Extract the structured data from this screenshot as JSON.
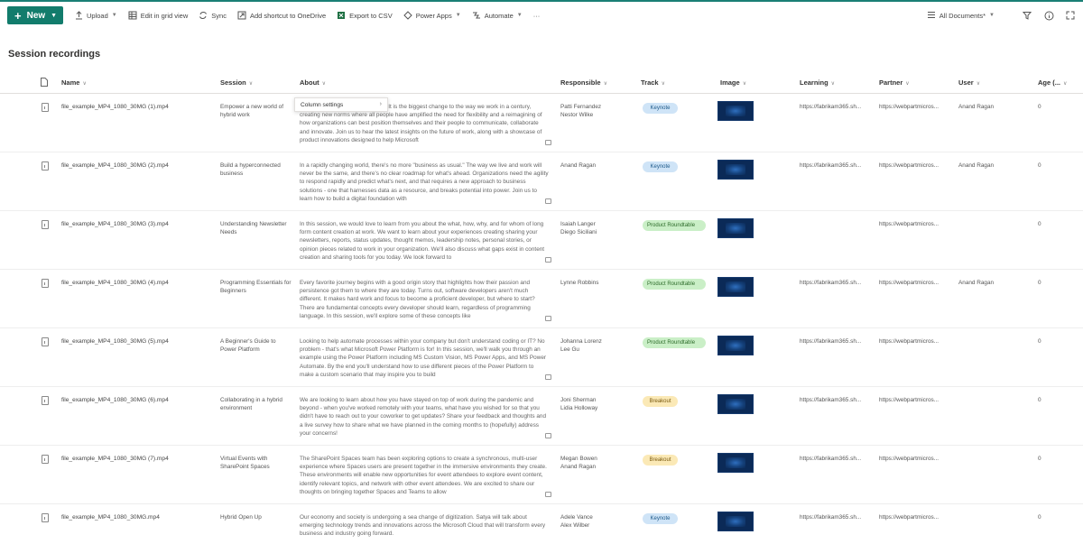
{
  "colors": {
    "accent": "#127c6c",
    "link": "#1e7d6c",
    "keynote": "#cfe4f7",
    "product": "#caefc7",
    "breakout": "#fbe9b6"
  },
  "toolbar": {
    "new_label": "New",
    "upload_label": "Upload",
    "grid_label": "Edit in grid view",
    "sync_label": "Sync",
    "shortcut_label": "Add shortcut to OneDrive",
    "export_label": "Export to CSV",
    "powerapps_label": "Power Apps",
    "automate_label": "Automate",
    "more_label": "···",
    "view_label": "All Documents*"
  },
  "page": {
    "title": "Session recordings"
  },
  "columns": {
    "name": "Name",
    "session": "Session",
    "about": "About",
    "responsible": "Responsible",
    "track": "Track",
    "image": "Image",
    "learning": "Learning",
    "partner": "Partner",
    "user": "User",
    "age": "Age (..."
  },
  "tooltip": {
    "label": "Column settings"
  },
  "rows": [
    {
      "name": "file_example_MP4_1080_30MG (1).mp4",
      "session": "Empower a new world of hybrid work",
      "about": "Work has fundamentally changed. It is the biggest change to the way we work in a century, creating new norms where all people have amplified the need for flexibility and a reimagining of how organizations can best position themselves and their people to communicate, collaborate and innovate. Join us to hear the latest insights on the future of work, along with a showcase of product innovations designed to help Microsoft",
      "responsible": "Patti Fernandez\nNestor Wilke",
      "track": "Keynote",
      "track_type": "keynote",
      "learning": "https://fabrikam365.sh...",
      "partner": "https://webpartmicros...",
      "user": "Anand Ragan",
      "age": "0"
    },
    {
      "name": "file_example_MP4_1080_30MG (2).mp4",
      "session": "Build a hyperconnected business",
      "about": "In a rapidly changing world, there's no more \"business as usual.\" The way we live and work will never be the same, and there's no clear roadmap for what's ahead. Organizations need the agility to respond rapidly and predict what's next, and that requires a new approach to business solutions - one that harnesses data as a resource, and breaks potential into power. Join us to learn how to build a digital foundation with",
      "responsible": "Anand Ragan",
      "track": "Keynote",
      "track_type": "keynote",
      "learning": "https://fabrikam365.sh...",
      "partner": "https://webpartmicros...",
      "user": "Anand Ragan",
      "age": "0"
    },
    {
      "name": "file_example_MP4_1080_30MG (3).mp4",
      "session": "Understanding Newsletter Needs",
      "about": "In this session, we would love to learn from you about the what, how, why, and for whom of long form content creation at work. We want to learn about your experiences creating sharing your newsletters, reports, status updates, thought memos, leadership notes, personal stories, or opinion pieces related to work in your organization. We'll also discuss what gaps exist in content creation and sharing tools for you today. We look forward to",
      "responsible": "Isaiah Langer\nDiego Siciliani",
      "track": "Product Roundtable",
      "track_type": "product",
      "learning": "",
      "partner": "https://webpartmicros...",
      "user": "",
      "age": "0"
    },
    {
      "name": "file_example_MP4_1080_30MG (4).mp4",
      "session": "Programming Essentials for Beginners",
      "about": "Every favorite journey begins with a good origin story that highlights how their passion and persistence got them to where they are today. Turns out, software developers aren't much different. It makes hard work and focus to become a proficient developer, but where to start? There are fundamental concepts every developer should learn, regardless of programming language. In this session, we'll explore some of these concepts like",
      "responsible": "Lynne Robbins",
      "track": "Product Roundtable",
      "track_type": "product",
      "learning": "https://fabrikam365.sh...",
      "partner": "https://webpartmicros...",
      "user": "Anand Ragan",
      "age": "0"
    },
    {
      "name": "file_example_MP4_1080_30MG (5).mp4",
      "session": "A Beginner's Guide to Power Platform",
      "about": "Looking to help automate processes within your company but don't understand coding or IT? No problem - that's what Microsoft Power Platform is for! In this session, we'll walk you through an example using the Power Platform including MS Custom Vision, MS Power Apps, and MS Power Automate. By the end you'll understand how to use different pieces of the Power Platform to make a custom scenario that may inspire you to build",
      "responsible": "Johanna Lorenz\nLee Gu",
      "track": "Product Roundtable",
      "track_type": "product",
      "learning": "https://fabrikam365.sh...",
      "partner": "https://webpartmicros...",
      "user": "",
      "age": "0"
    },
    {
      "name": "file_example_MP4_1080_30MG (6).mp4",
      "session": "Collaborating in a hybrid environment",
      "about": "We are looking to learn about how you have stayed on top of work during the pandemic and beyond - when you've worked remotely with your teams, what have you wished for so that you didn't have to reach out to your coworker to get updates? Share your feedback and thoughts and a live survey how to share what we have planned in the coming months to (hopefully) address your concerns!",
      "responsible": "Joni Sherman\nLidia Holloway",
      "track": "Breakout",
      "track_type": "breakout",
      "learning": "https://fabrikam365.sh...",
      "partner": "https://webpartmicros...",
      "user": "",
      "age": "0"
    },
    {
      "name": "file_example_MP4_1080_30MG (7).mp4",
      "session": "Virtual Events with SharePoint Spaces",
      "about": "The SharePoint Spaces team has been exploring options to create a synchronous, multi-user experience where Spaces users are present together in the immersive environments they create. These environments will enable new opportunities for event attendees to explore event content, identify relevant topics, and network with other event attendees. We are excited to share our thoughts on bringing together Spaces and Teams to allow",
      "responsible": "Megan Bowen\nAnand Ragan",
      "track": "Breakout",
      "track_type": "breakout",
      "learning": "https://fabrikam365.sh...",
      "partner": "https://webpartmicros...",
      "user": "",
      "age": "0"
    },
    {
      "name": "file_example_MP4_1080_30MG.mp4",
      "session": "Hybrid Open Up",
      "about": "Our economy and society is undergoing a sea change of digitization. Satya will talk about emerging technology trends and innovations across the Microsoft Cloud that will transform every business and industry going forward.",
      "responsible": "Adele Vance\nAlex Wilber",
      "track": "Keynote",
      "track_type": "keynote",
      "learning": "https://fabrikam365.sh...",
      "partner": "https://webpartmicros...",
      "user": "",
      "age": "0"
    }
  ]
}
